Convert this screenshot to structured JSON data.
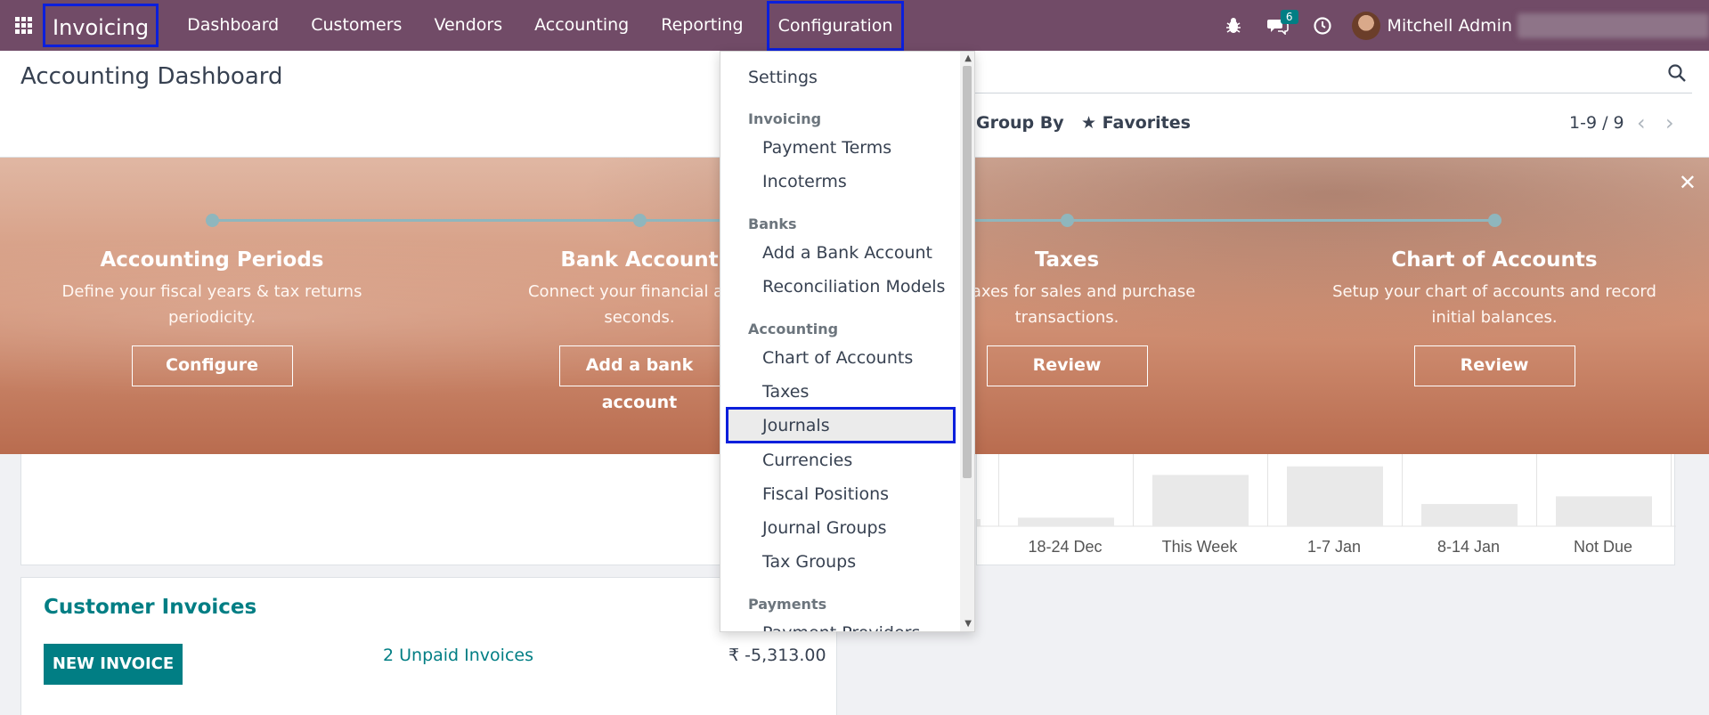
{
  "navbar": {
    "brand": "Invoicing",
    "menu": [
      "Dashboard",
      "Customers",
      "Vendors",
      "Accounting",
      "Reporting"
    ],
    "active_menu": "Configuration",
    "chat_count": "6",
    "user": "Mitchell Admin",
    "bg_color": "#714b67"
  },
  "control": {
    "title": "Accounting Dashboard",
    "group_by": "Group By",
    "favorites": "Favorites",
    "pager": "1-9 / 9"
  },
  "banner": {
    "steps": [
      {
        "title": "Accounting Periods",
        "desc1": "Define your fiscal years & tax returns",
        "desc2": "periodicity.",
        "button": "Configure"
      },
      {
        "title": "Bank Account",
        "desc1": "Connect your financial acco",
        "desc2": "seconds.",
        "button": "Add a bank account"
      },
      {
        "title": "Taxes",
        "desc1": "ult Taxes for sales and purchase",
        "desc2": "transactions.",
        "button": "Review"
      },
      {
        "title": "Chart of Accounts",
        "desc1": "Setup your chart of accounts and record",
        "desc2": "initial balances.",
        "button": "Review"
      }
    ]
  },
  "dropdown": {
    "settings": "Settings",
    "sections": [
      {
        "header": "Invoicing",
        "items": [
          "Payment Terms",
          "Incoterms"
        ]
      },
      {
        "header": "Banks",
        "items": [
          "Add a Bank Account",
          "Reconciliation Models"
        ]
      },
      {
        "header": "Accounting",
        "items": [
          "Chart of Accounts",
          "Taxes",
          "Journals",
          "Currencies",
          "Fiscal Positions",
          "Journal Groups",
          "Tax Groups"
        ]
      },
      {
        "header": "Payments",
        "items": [
          "Payment Providers"
        ]
      }
    ],
    "highlighted": "Journals"
  },
  "chart_data": {
    "type": "bar",
    "categories": [
      "18-24 Dec",
      "This Week",
      "1-7 Jan",
      "8-14 Jan",
      "Not Due"
    ],
    "values": [
      1,
      6,
      7,
      2.6,
      3.5
    ],
    "ylim": [
      0,
      7.5
    ]
  },
  "customer_invoices": {
    "title": "Customer Invoices",
    "new_button": "NEW INVOICE",
    "unpaid": "2 Unpaid Invoices",
    "amount": "₹ -5,313.00"
  }
}
